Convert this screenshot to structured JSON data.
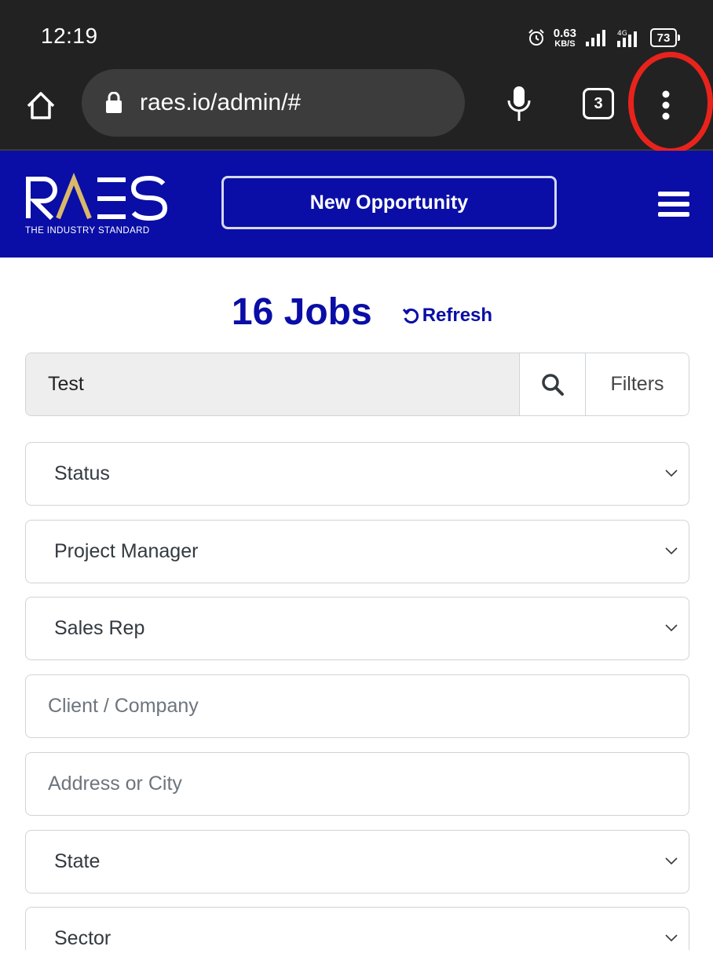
{
  "status_bar": {
    "time": "12:19",
    "net_speed_value": "0.63",
    "net_speed_unit": "KB/S",
    "network_type": "4G",
    "battery": "73",
    "icons": [
      "alarm-icon",
      "signal-icon",
      "lte-signal-icon"
    ]
  },
  "browser": {
    "url": "raes.io/admin/#",
    "tab_count": "3",
    "icons": [
      "home-icon",
      "lock-icon",
      "mic-icon",
      "more-vert-icon"
    ]
  },
  "header": {
    "logo_text": "RAES",
    "logo_tagline": "THE INDUSTRY STANDARD",
    "new_opportunity_label": "New Opportunity",
    "brand_color": "#0a0ea6"
  },
  "main": {
    "jobs_title": "16 Jobs",
    "refresh_label": "Refresh",
    "search": {
      "value": "Test",
      "filters_label": "Filters"
    },
    "filters": [
      {
        "type": "select",
        "label": "Status"
      },
      {
        "type": "select",
        "label": "Project Manager"
      },
      {
        "type": "select",
        "label": "Sales Rep"
      },
      {
        "type": "input",
        "placeholder": "Client / Company"
      },
      {
        "type": "input",
        "placeholder": "Address or City"
      },
      {
        "type": "select",
        "label": "State"
      },
      {
        "type": "select",
        "label": "Sector"
      }
    ]
  },
  "annotation": {
    "highlight_color": "#e8231c",
    "highlighted_element": "more-vert-icon"
  }
}
